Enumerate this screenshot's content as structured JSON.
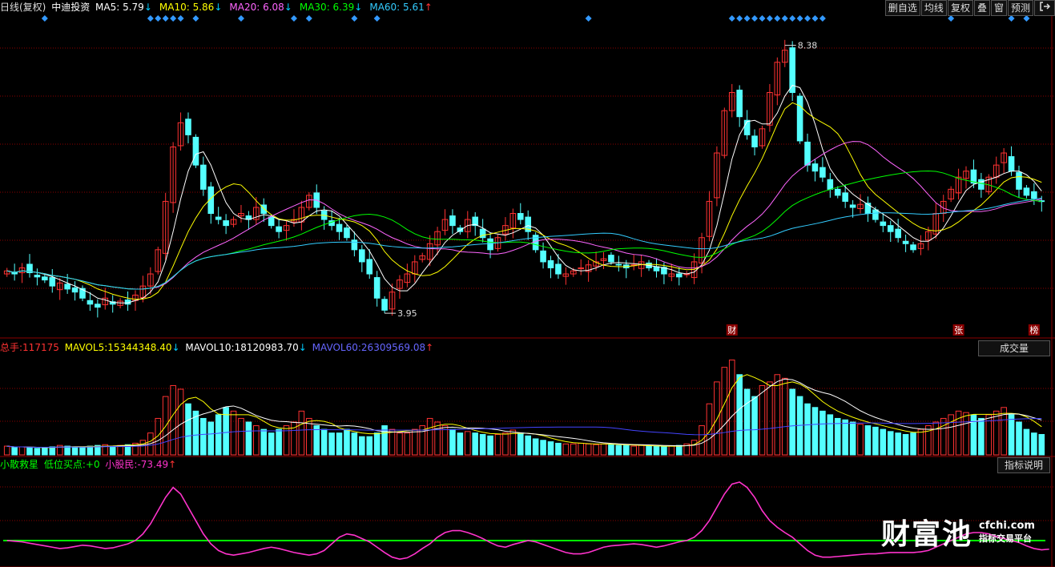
{
  "header": {
    "period": "日线(复权)",
    "stock": "中迪投资",
    "ma": [
      {
        "label": "MA5:",
        "value": "5.79",
        "dir": "down",
        "color": "#ffffff"
      },
      {
        "label": "MA10:",
        "value": "5.86",
        "dir": "down",
        "color": "#ffff00"
      },
      {
        "label": "MA20:",
        "value": "6.08",
        "dir": "down",
        "color": "#ff66ff"
      },
      {
        "label": "MA30:",
        "value": "6.39",
        "dir": "down",
        "color": "#00ff00"
      },
      {
        "label": "MA60:",
        "value": "5.61",
        "dir": "up",
        "color": "#33ccff"
      }
    ]
  },
  "toolbar": {
    "buttons": [
      "删自选",
      "均线",
      "复权",
      "叠",
      "窗",
      "预测"
    ],
    "exit_icon": "exit-icon"
  },
  "volume_header": {
    "total_label": "总手:",
    "total_value": "117175",
    "mavol5_label": "MAVOL5:",
    "mavol5_value": "15344348.40",
    "mavol10_label": "MAVOL10:",
    "mavol10_value": "18120983.70",
    "mavol60_label": "MAVOL60:",
    "mavol60_value": "26309569.08",
    "volume_button": "成交量"
  },
  "indicator_header": {
    "name": "小散救星",
    "low_buy_label": "低位买点:",
    "low_buy_value": "+0",
    "small_label": "小股民:",
    "small_value": "-73.49",
    "explain_button": "指标说明"
  },
  "markers": {
    "cai": "财",
    "zhang": "张",
    "bang": "榜"
  },
  "annotations": {
    "high": "8.38",
    "low": "3.95"
  },
  "watermark": {
    "big": "财富池",
    "domain": "cfchi.com",
    "sub": "指标交易平台"
  },
  "colors": {
    "up": "#ff3232",
    "down": "#54ffff",
    "bg": "#000000",
    "grid": "#8b0000",
    "ma5": "#ffffff",
    "ma10": "#ffff00",
    "ma20": "#ff66ff",
    "ma30": "#00ff00",
    "ma60": "#33ccff",
    "indicator": "#ff33cc",
    "baseline": "#00ff00",
    "diamond": "#3399ff"
  },
  "chart_data": {
    "type": "candlestick",
    "price_range": [
      3.7,
      8.6
    ],
    "closes": [
      4.65,
      4.6,
      4.7,
      4.62,
      4.55,
      4.5,
      4.4,
      4.45,
      4.35,
      4.3,
      4.2,
      4.1,
      4.05,
      4.2,
      4.1,
      4.15,
      4.1,
      4.25,
      4.4,
      4.6,
      5.0,
      5.8,
      6.7,
      7.1,
      6.9,
      6.4,
      6.0,
      5.6,
      5.5,
      5.4,
      5.5,
      5.6,
      5.5,
      5.7,
      5.6,
      5.4,
      5.3,
      5.4,
      5.5,
      5.7,
      5.9,
      5.7,
      5.5,
      5.4,
      5.3,
      5.2,
      5.0,
      4.8,
      4.6,
      4.2,
      4.0,
      4.3,
      4.5,
      4.6,
      4.8,
      4.9,
      5.1,
      5.3,
      5.5,
      5.4,
      5.3,
      5.5,
      5.4,
      5.2,
      5.0,
      5.2,
      5.4,
      5.6,
      5.5,
      5.3,
      5.0,
      4.8,
      4.7,
      4.6,
      4.6,
      4.65,
      4.7,
      4.75,
      4.8,
      4.85,
      4.8,
      4.75,
      4.7,
      4.75,
      4.8,
      4.7,
      4.65,
      4.6,
      4.6,
      4.55,
      4.6,
      4.8,
      5.2,
      5.8,
      6.6,
      7.3,
      7.6,
      7.2,
      6.9,
      6.7,
      7.0,
      7.6,
      8.1,
      8.3,
      7.6,
      6.8,
      6.4,
      6.3,
      6.2,
      6.0,
      5.9,
      5.8,
      5.7,
      5.75,
      5.6,
      5.5,
      5.4,
      5.3,
      5.2,
      5.1,
      5.0,
      5.1,
      5.3,
      5.6,
      5.8,
      6.0,
      6.2,
      6.3,
      6.1,
      6.0,
      6.2,
      6.4,
      6.6,
      6.3,
      6.0,
      5.9,
      5.85,
      5.8
    ],
    "volumes": [
      1.2,
      1.0,
      1.1,
      1.0,
      0.9,
      1.0,
      1.1,
      1.3,
      1.2,
      1.1,
      1.0,
      1.2,
      1.3,
      1.4,
      1.2,
      1.3,
      1.4,
      1.6,
      2.0,
      3.0,
      5.0,
      8.0,
      9.5,
      9.0,
      7.0,
      6.0,
      5.0,
      4.5,
      5.5,
      6.5,
      6.0,
      5.0,
      4.5,
      4.0,
      3.5,
      3.0,
      3.5,
      4.0,
      4.5,
      6.0,
      5.0,
      4.0,
      3.5,
      3.0,
      3.0,
      3.5,
      3.0,
      2.5,
      2.5,
      3.0,
      4.0,
      3.5,
      3.0,
      3.0,
      3.5,
      4.0,
      5.0,
      4.5,
      4.0,
      3.5,
      3.0,
      3.2,
      3.0,
      2.8,
      2.6,
      2.8,
      3.0,
      3.4,
      3.0,
      2.6,
      2.2,
      2.0,
      1.8,
      1.6,
      1.5,
      1.5,
      1.6,
      1.5,
      1.4,
      1.5,
      1.4,
      1.3,
      1.3,
      1.2,
      1.3,
      1.2,
      1.2,
      1.1,
      1.2,
      1.3,
      1.5,
      2.0,
      4.0,
      7.0,
      10.0,
      12.0,
      13.0,
      11.0,
      9.0,
      8.0,
      9.5,
      10.0,
      11.0,
      10.5,
      9.0,
      8.0,
      7.0,
      6.5,
      6.0,
      5.5,
      5.0,
      4.8,
      4.5,
      4.2,
      4.0,
      3.8,
      3.5,
      3.2,
      3.0,
      2.8,
      3.0,
      3.5,
      4.0,
      4.5,
      5.0,
      5.5,
      6.0,
      5.8,
      5.5,
      5.0,
      5.5,
      6.0,
      6.5,
      5.5,
      4.5,
      3.5,
      3.0,
      2.8
    ],
    "volume_range": [
      0,
      13.5
    ],
    "indicator": [
      0,
      -1,
      -2,
      -4,
      -6,
      -8,
      -10,
      -12,
      -11,
      -9,
      -7,
      -8,
      -10,
      -12,
      -11,
      -8,
      -5,
      0,
      10,
      25,
      45,
      65,
      80,
      70,
      50,
      30,
      10,
      -5,
      -15,
      -20,
      -22,
      -20,
      -18,
      -15,
      -12,
      -10,
      -12,
      -15,
      -18,
      -20,
      -22,
      -20,
      -15,
      -5,
      5,
      10,
      8,
      3,
      -2,
      -10,
      -18,
      -25,
      -28,
      -26,
      -20,
      -12,
      -5,
      5,
      12,
      15,
      15,
      12,
      8,
      3,
      -3,
      -8,
      -10,
      -6,
      -3,
      0,
      -2,
      -6,
      -10,
      -14,
      -18,
      -20,
      -20,
      -18,
      -14,
      -10,
      -8,
      -7,
      -6,
      -5,
      -6,
      -8,
      -10,
      -8,
      -5,
      -2,
      0,
      5,
      15,
      30,
      50,
      70,
      85,
      88,
      80,
      65,
      45,
      30,
      20,
      12,
      5,
      -5,
      -15,
      -22,
      -25,
      -25,
      -24,
      -23,
      -22,
      -21,
      -20,
      -20,
      -19,
      -18,
      -18,
      -18,
      -18,
      -17,
      -15,
      -10,
      -5,
      0,
      5,
      10,
      12,
      12,
      10,
      6,
      3,
      0,
      -3,
      -8,
      -12,
      -14,
      -13
    ],
    "indicator_range": [
      -35,
      100
    ],
    "max_label": "8.38",
    "min_label": "3.95"
  }
}
